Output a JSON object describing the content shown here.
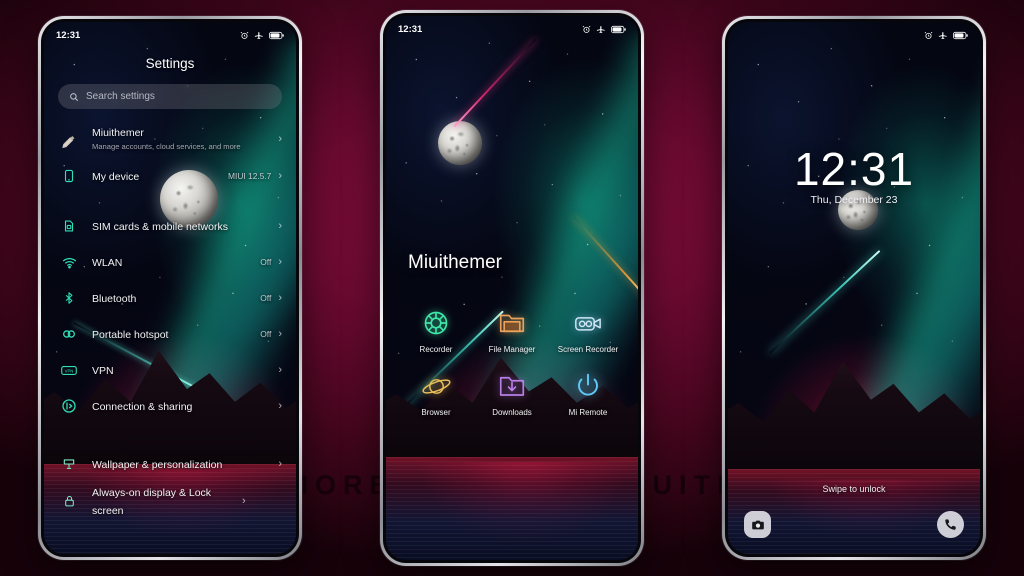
{
  "background": {
    "accent": "#7d0d3a",
    "dark": "#17020a"
  },
  "watermark": {
    "text": "VISIT FOR MORE THEMES - MIUITHEMER.COM"
  },
  "theme": {
    "name": "Miuithemer",
    "icon_accent": "#2fe0b8"
  },
  "phone1": {
    "statusbar": {
      "time": "12:31",
      "icons": [
        "alarm-icon",
        "airplane-mode-icon",
        "battery-icon"
      ]
    },
    "header": {
      "title": "Settings"
    },
    "search": {
      "placeholder": "Search settings",
      "icon": "search-icon"
    },
    "items": [
      {
        "icon": "account-icon",
        "title": "Miuithemer",
        "subtitle": "Manage accounts, cloud services, and more",
        "value": "",
        "chevron": "›"
      },
      {
        "icon": "phone-device-icon",
        "title": "My device",
        "subtitle": "",
        "value": "MIUI 12.5.7",
        "chevron": "›"
      },
      {
        "icon": "sim-card-icon",
        "title": "SIM cards & mobile networks",
        "subtitle": "",
        "value": "",
        "chevron": "›"
      },
      {
        "icon": "wifi-icon",
        "title": "WLAN",
        "subtitle": "",
        "value": "Off",
        "chevron": "›"
      },
      {
        "icon": "bluetooth-icon",
        "title": "Bluetooth",
        "subtitle": "",
        "value": "Off",
        "chevron": "›"
      },
      {
        "icon": "hotspot-icon",
        "title": "Portable hotspot",
        "subtitle": "",
        "value": "Off",
        "chevron": "›"
      },
      {
        "icon": "vpn-icon",
        "title": "VPN",
        "subtitle": "",
        "value": "",
        "chevron": "›"
      },
      {
        "icon": "connection-share-icon",
        "title": "Connection & sharing",
        "subtitle": "",
        "value": "",
        "chevron": "›"
      },
      {
        "icon": "wallpaper-icon",
        "title": "Wallpaper & personalization",
        "subtitle": "",
        "value": "",
        "chevron": "›"
      },
      {
        "icon": "lock-icon",
        "title": "Always-on display & Lock screen",
        "subtitle": "",
        "value": "",
        "chevron": "›"
      }
    ]
  },
  "phone2": {
    "statusbar": {
      "time": "12:31",
      "icons": [
        "alarm-icon",
        "airplane-mode-icon",
        "battery-icon"
      ]
    },
    "title": "Miuithemer",
    "apps": [
      {
        "icon": "recorder-icon",
        "label": "Recorder",
        "color": "#3fe6a8"
      },
      {
        "icon": "folder-icon",
        "label": "File Manager",
        "color": "#e8a25c"
      },
      {
        "icon": "video-camera-icon",
        "label": "Screen Recorder",
        "color": "#cfe6f7"
      },
      {
        "icon": "planet-icon",
        "label": "Browser",
        "color": "#e8c05a"
      },
      {
        "icon": "download-folder-icon",
        "label": "Downloads",
        "color": "#b97fe8"
      },
      {
        "icon": "power-icon",
        "label": "Mi Remote",
        "color": "#5fc8f5"
      }
    ]
  },
  "phone3": {
    "statusbar": {
      "time": "",
      "icons": [
        "alarm-icon",
        "airplane-mode-icon",
        "battery-icon"
      ]
    },
    "time": "12:31",
    "date": "Thu, December 23",
    "swipe_hint": "Swipe to unlock",
    "shortcuts": [
      {
        "icon": "camera-icon",
        "name": "camera-shortcut"
      },
      {
        "icon": "phone-icon",
        "name": "phone-shortcut"
      }
    ]
  }
}
